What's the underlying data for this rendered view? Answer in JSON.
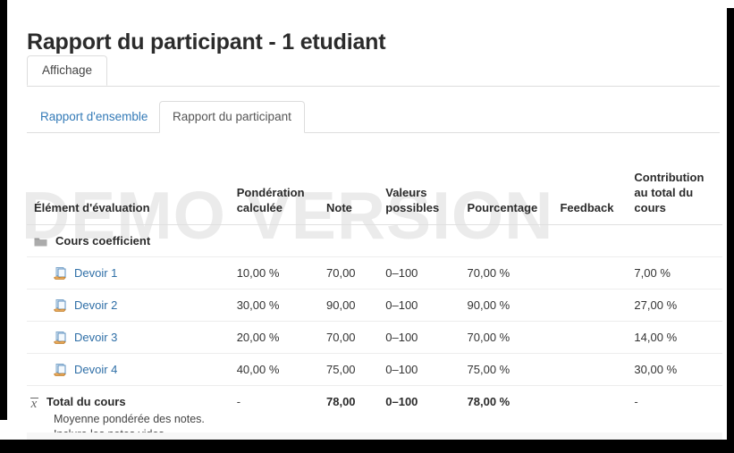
{
  "page": {
    "title": "Rapport du participant - 1 etudiant",
    "watermark": "DEMO VERSION"
  },
  "primary_tabs": [
    {
      "label": "Affichage",
      "active": true
    }
  ],
  "secondary_tabs": [
    {
      "label": "Rapport d'ensemble",
      "active": false
    },
    {
      "label": "Rapport du participant",
      "active": true
    }
  ],
  "table": {
    "headers": {
      "item": "Élément d'évaluation",
      "weight": "Pondération calculée",
      "grade": "Note",
      "range": "Valeurs possibles",
      "percentage": "Pourcentage",
      "feedback": "Feedback",
      "contribution": "Contribution au total du cours"
    },
    "category": {
      "name": "Cours coefficient",
      "icon": "folder-icon"
    },
    "rows": [
      {
        "icon": "assignment-icon",
        "name": "Devoir 1",
        "weight": "10,00 %",
        "grade": "70,00",
        "range": "0–100",
        "percentage": "70,00 %",
        "feedback": "",
        "contribution": "7,00 %"
      },
      {
        "icon": "assignment-icon",
        "name": "Devoir 2",
        "weight": "30,00 %",
        "grade": "90,00",
        "range": "0–100",
        "percentage": "90,00 %",
        "feedback": "",
        "contribution": "27,00 %"
      },
      {
        "icon": "assignment-icon",
        "name": "Devoir 3",
        "weight": "20,00 %",
        "grade": "70,00",
        "range": "0–100",
        "percentage": "70,00 %",
        "feedback": "",
        "contribution": "14,00 %"
      },
      {
        "icon": "assignment-icon",
        "name": "Devoir 4",
        "weight": "40,00 %",
        "grade": "75,00",
        "range": "0–100",
        "percentage": "75,00 %",
        "feedback": "",
        "contribution": "30,00 %"
      }
    ],
    "total": {
      "icon": "mean-icon",
      "name": "Total du cours",
      "note_line1": "Moyenne pondérée des notes.",
      "note_line2": "Inclure les notes vides.",
      "weight": "-",
      "grade": "78,00",
      "range": "0–100",
      "percentage": "78,00 %",
      "feedback": "",
      "contribution": "-"
    }
  },
  "colors": {
    "link": "#2f6fa7",
    "tab_link": "#337ab7",
    "text": "#333333",
    "heading": "#2b2b2b",
    "watermark": "#ebebeb",
    "border": "#dddddd",
    "total_bg": "#f7f7f7",
    "frame": "#000000"
  }
}
